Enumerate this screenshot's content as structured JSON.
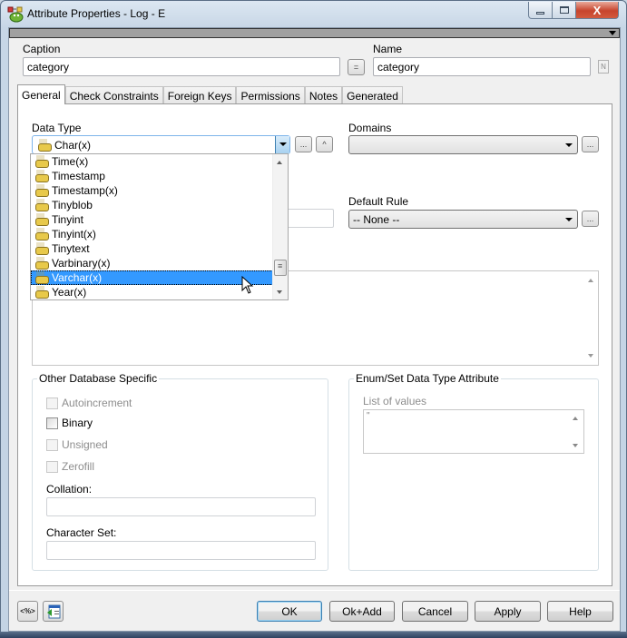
{
  "window": {
    "title": "Attribute Properties - Log - E",
    "controls": {
      "minimize": "—",
      "maximize": "□",
      "close": "X"
    }
  },
  "caption": {
    "label": "Caption",
    "value": "category"
  },
  "equals_button": "=",
  "name": {
    "label": "Name",
    "value": "category",
    "naming_button": "N"
  },
  "tabs": [
    {
      "label": "General",
      "active": true
    },
    {
      "label": "Check Constraints",
      "active": false
    },
    {
      "label": "Foreign Keys",
      "active": false
    },
    {
      "label": "Permissions",
      "active": false
    },
    {
      "label": "Notes",
      "active": false
    },
    {
      "label": "Generated",
      "active": false
    }
  ],
  "general": {
    "data_type": {
      "label": "Data Type",
      "value": "Char(x)",
      "more_button": "...",
      "up_button": "^",
      "dropdown_items": [
        {
          "label": "Time(x)",
          "selected": false
        },
        {
          "label": "Timestamp",
          "selected": false
        },
        {
          "label": "Timestamp(x)",
          "selected": false
        },
        {
          "label": "Tinyblob",
          "selected": false
        },
        {
          "label": "Tinyint",
          "selected": false
        },
        {
          "label": "Tinyint(x)",
          "selected": false
        },
        {
          "label": "Tinytext",
          "selected": false
        },
        {
          "label": "Varbinary(x)",
          "selected": false
        },
        {
          "label": "Varchar(x)",
          "selected": true
        },
        {
          "label": "Year(x)",
          "selected": false
        }
      ],
      "dropdown_scroll_position": 0.93
    },
    "domains": {
      "label": "Domains",
      "value": "",
      "more_button": "..."
    },
    "default_rule": {
      "label": "Default Rule",
      "value": "-- None --",
      "more_button": "..."
    },
    "other_db_specific": {
      "title": "Other Database Specific",
      "checkboxes": [
        {
          "label": "Autoincrement",
          "checked": false,
          "enabled": false
        },
        {
          "label": "Binary",
          "checked": false,
          "enabled": true
        },
        {
          "label": "Unsigned",
          "checked": false,
          "enabled": false
        },
        {
          "label": "Zerofill",
          "checked": false,
          "enabled": false
        }
      ],
      "collation": {
        "label": "Collation:",
        "value": ""
      },
      "character_set": {
        "label": "Character Set:",
        "value": ""
      }
    },
    "enum_set": {
      "title": "Enum/Set Data Type Attribute",
      "list_label": "List of values",
      "list_value": "\""
    }
  },
  "footer": {
    "left_icons": [
      {
        "name": "macro-tag-icon",
        "glyph": "<%>"
      },
      {
        "name": "window-arrow-icon",
        "glyph": ""
      }
    ],
    "buttons": {
      "ok": "OK",
      "ok_add": "Ok+Add",
      "cancel": "Cancel",
      "apply": "Apply",
      "help": "Help"
    }
  }
}
